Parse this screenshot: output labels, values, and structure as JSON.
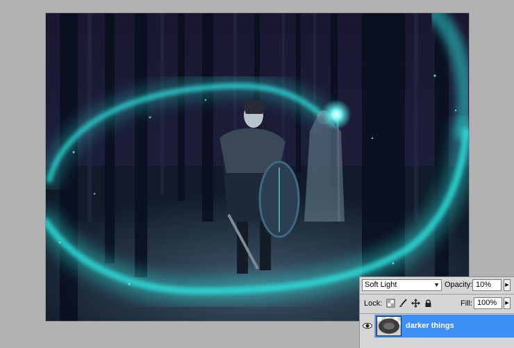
{
  "layers_panel": {
    "blend_mode": "Soft Light",
    "opacity_label": "Opacity:",
    "opacity_value": "10%",
    "lock_label": "Lock:",
    "lock_icons": [
      "lock-transparent-pixels-icon",
      "lock-image-pixels-icon",
      "lock-position-icon",
      "lock-all-icon"
    ],
    "fill_label": "Fill:",
    "fill_value": "100%",
    "layer": {
      "name": "darker things",
      "visible": true,
      "selected": true,
      "selected_color": "#3d8ff6"
    }
  },
  "colors": {
    "workspace_bg": "#b2b2b2",
    "glow_accent": "#2ee6e0"
  }
}
